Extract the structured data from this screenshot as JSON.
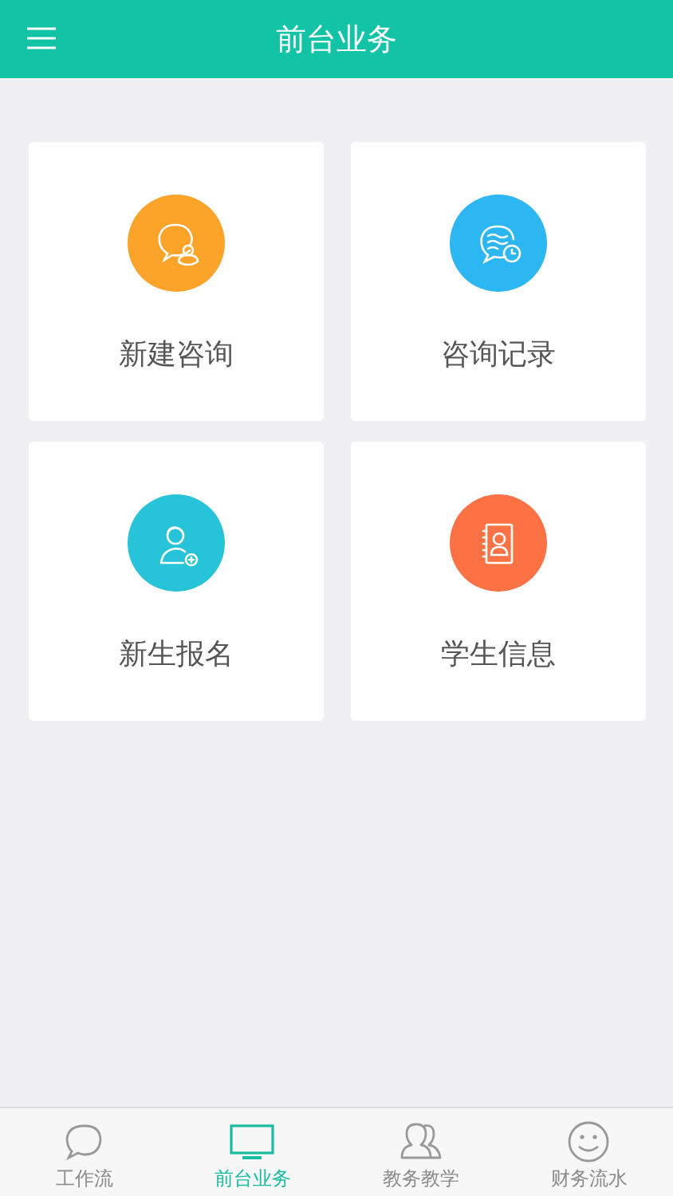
{
  "header": {
    "title": "前台业务"
  },
  "tiles": [
    {
      "label": "新建咨询",
      "kind": "chat-person",
      "color": "#fca42a"
    },
    {
      "label": "咨询记录",
      "kind": "chat-clock",
      "color": "#2cb6f2"
    },
    {
      "label": "新生报名",
      "kind": "person-add",
      "color": "#26c3d9"
    },
    {
      "label": "学生信息",
      "kind": "contact-book",
      "color": "#fd7244"
    }
  ],
  "tab_bar": [
    {
      "label": "工作流",
      "kind": "chat",
      "selected": false
    },
    {
      "label": "前台业务",
      "kind": "monitor",
      "selected": true
    },
    {
      "label": "教务教学",
      "kind": "people",
      "selected": false
    },
    {
      "label": "财务流水",
      "kind": "smile",
      "selected": false
    }
  ]
}
